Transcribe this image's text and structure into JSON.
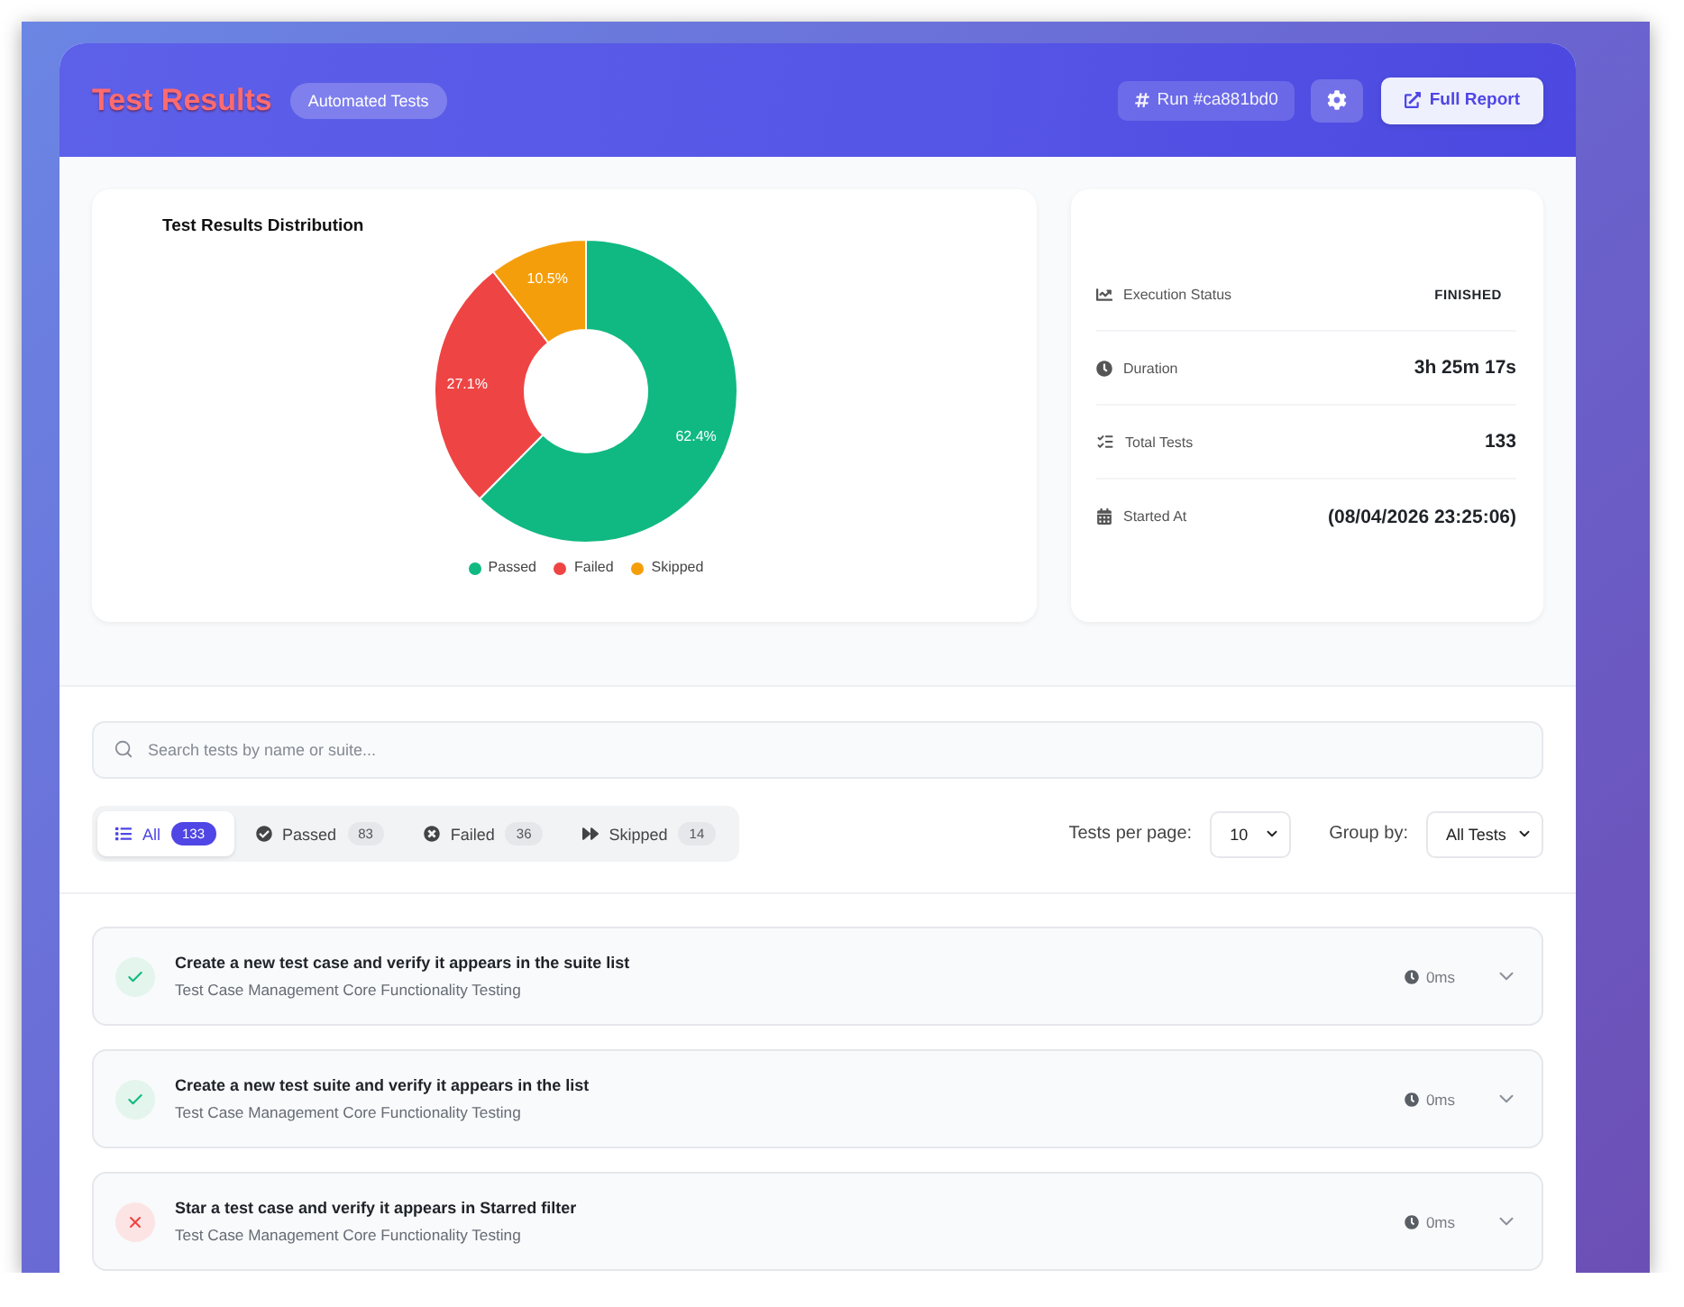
{
  "header": {
    "title": "Test Results",
    "badge": "Automated Tests",
    "run_id": "Run #ca881bd0",
    "report_button": "Full Report"
  },
  "chart": {
    "chart_data": {
      "type": "donut",
      "title": "Test Results Distribution",
      "categories": [
        "Passed",
        "Failed",
        "Skipped"
      ],
      "values": [
        62.4,
        27.1,
        10.5
      ],
      "value_labels": [
        "62.4%",
        "27.1%",
        "10.5%"
      ]
    },
    "legend": [
      {
        "color": "#10b981"
      },
      {
        "color": "#ef4444"
      },
      {
        "color": "#f59e0b"
      }
    ]
  },
  "stats": [
    {
      "kind": "status",
      "label": "Execution Status",
      "value": "FINISHED"
    },
    {
      "kind": "duration",
      "label": "Duration",
      "value": "3h 25m 17s"
    },
    {
      "kind": "count",
      "label": "Total Tests",
      "value": "133"
    },
    {
      "kind": "date",
      "label": "Started At",
      "value": "(08/04/2026 23:25:06)"
    }
  ],
  "search": {
    "placeholder": "Search tests by name or suite..."
  },
  "filters": [
    {
      "kind": "all",
      "label": "All",
      "count": "133",
      "selected": true
    },
    {
      "kind": "passed",
      "label": "Passed",
      "count": "83",
      "selected": false
    },
    {
      "kind": "failed",
      "label": "Failed",
      "count": "36",
      "selected": false
    },
    {
      "kind": "skipped",
      "label": "Skipped",
      "count": "14",
      "selected": false
    }
  ],
  "tests_per_page": {
    "label": "Tests per page:",
    "value": "10"
  },
  "group_by": {
    "label": "Group by:",
    "value": "All Tests"
  },
  "tests": [
    {
      "kind": "passed",
      "title": "Create a new test case and verify it appears in the suite list",
      "suite": "Test Case Management Core Functionality Testing",
      "duration": "0ms",
      "expanded": false
    },
    {
      "kind": "passed",
      "title": "Create a new test suite and verify it appears in the list",
      "suite": "Test Case Management Core Functionality Testing",
      "duration": "0ms",
      "expanded": false
    },
    {
      "kind": "failed",
      "title": "Star a test case and verify it appears in Starred filter",
      "suite": "Test Case Management Core Functionality Testing",
      "duration": "0ms",
      "expanded": false
    }
  ]
}
